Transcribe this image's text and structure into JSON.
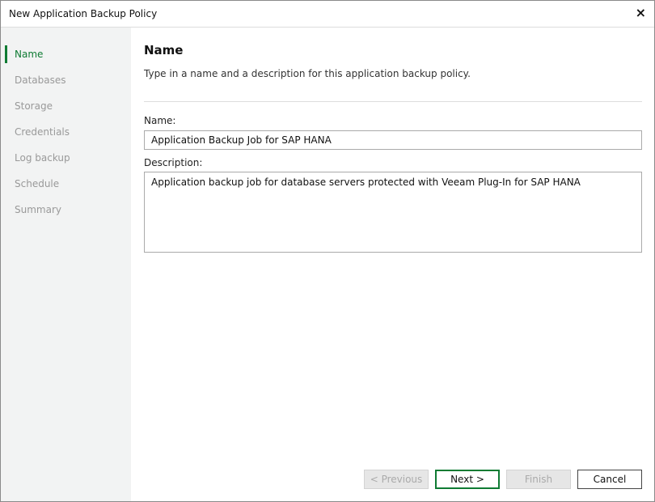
{
  "window": {
    "title": "New Application Backup Policy",
    "close_icon": "×"
  },
  "steps": [
    "Name",
    "Databases",
    "Storage",
    "Credentials",
    "Log backup",
    "Schedule",
    "Summary"
  ],
  "main": {
    "heading": "Name",
    "subtitle": "Type in a name and a description for this application backup policy.",
    "name_label": "Name:",
    "name_value": "Application Backup Job for SAP HANA",
    "description_label": "Description:",
    "description_value": "Application backup job for database servers protected with Veeam Plug-In for SAP HANA"
  },
  "buttons": {
    "previous": "< Previous",
    "next": "Next >",
    "finish": "Finish",
    "cancel": "Cancel"
  },
  "colors": {
    "accent": "#0f7b33"
  }
}
